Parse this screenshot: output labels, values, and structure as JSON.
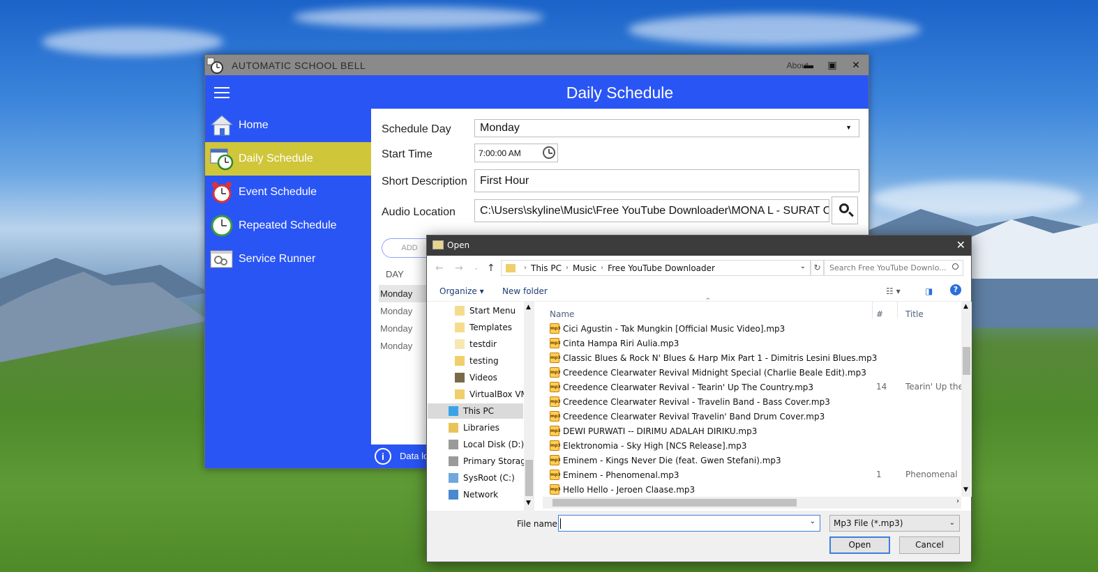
{
  "app": {
    "title": "AUTOMATIC SCHOOL BELL",
    "about": "About",
    "heading": "Daily Schedule",
    "nav": [
      {
        "label": "Home"
      },
      {
        "label": "Daily Schedule"
      },
      {
        "label": "Event Schedule"
      },
      {
        "label": "Repeated Schedule"
      },
      {
        "label": "Service Runner"
      }
    ],
    "form": {
      "schedule_day_label": "Schedule Day",
      "schedule_day_value": "Monday",
      "start_time_label": "Start Time",
      "start_time_value": "7:00:00 AM",
      "short_desc_label": "Short Description",
      "short_desc_value": "First Hour",
      "audio_label": "Audio Location",
      "audio_value": "C:\\Users\\skyline\\Music\\Free YouTube Downloader\\MONA L - SURAT C"
    },
    "add_label": "ADD",
    "day_header": "DAY",
    "day_rows": [
      "Monday",
      "Monday",
      "Monday",
      "Monday"
    ],
    "status_text": "Data lo"
  },
  "dialog": {
    "title": "Open",
    "breadcrumb": [
      "This PC",
      "Music",
      "Free YouTube Downloader"
    ],
    "search_placeholder": "Search Free YouTube Downlo...",
    "organize": "Organize",
    "new_folder": "New folder",
    "tree": [
      {
        "label": "Start Menu"
      },
      {
        "label": "Templates"
      },
      {
        "label": "testdir"
      },
      {
        "label": "testing"
      },
      {
        "label": "Videos"
      },
      {
        "label": "VirtualBox VMs"
      },
      {
        "label": "This PC"
      },
      {
        "label": "Libraries"
      },
      {
        "label": "Local Disk (D:)"
      },
      {
        "label": "Primary Storage"
      },
      {
        "label": "SysRoot (C:)"
      },
      {
        "label": "Network"
      }
    ],
    "columns": {
      "name": "Name",
      "num": "#",
      "title": "Title"
    },
    "files": [
      {
        "name": "Cici Agustin - Tak Mungkin [Official Music Video].mp3",
        "num": "",
        "title": ""
      },
      {
        "name": "Cinta Hampa Riri Aulia.mp3",
        "num": "",
        "title": ""
      },
      {
        "name": "Classic Blues & Rock N' Blues & Harp Mix Part 1 - Dimitris Lesini Blues.mp3",
        "num": "",
        "title": ""
      },
      {
        "name": "Creedence Clearwater Revival   Midnight Special (Charlie Beale Edit).mp3",
        "num": "",
        "title": ""
      },
      {
        "name": "Creedence Clearwater Revival - Tearin' Up The Country.mp3",
        "num": "14",
        "title": "Tearin' Up the C"
      },
      {
        "name": "Creedence Clearwater Revival - Travelin Band - Bass Cover.mp3",
        "num": "",
        "title": ""
      },
      {
        "name": "Creedence Clearwater Revival Travelin' Band Drum Cover.mp3",
        "num": "",
        "title": ""
      },
      {
        "name": "DEWI PURWATI -- DIRIMU ADALAH DIRIKU.mp3",
        "num": "",
        "title": ""
      },
      {
        "name": "Elektronomia - Sky High [NCS Release].mp3",
        "num": "",
        "title": ""
      },
      {
        "name": "Eminem - Kings Never Die (feat. Gwen Stefani).mp3",
        "num": "",
        "title": ""
      },
      {
        "name": "Eminem - Phenomenal.mp3",
        "num": "1",
        "title": "Phenomenal"
      },
      {
        "name": "Hello Hello - Jeroen Claase.mp3",
        "num": "",
        "title": ""
      }
    ],
    "file_name_label": "File name:",
    "file_name_value": "",
    "file_type": "Mp3 File (*.mp3)",
    "open_label": "Open",
    "cancel_label": "Cancel"
  }
}
